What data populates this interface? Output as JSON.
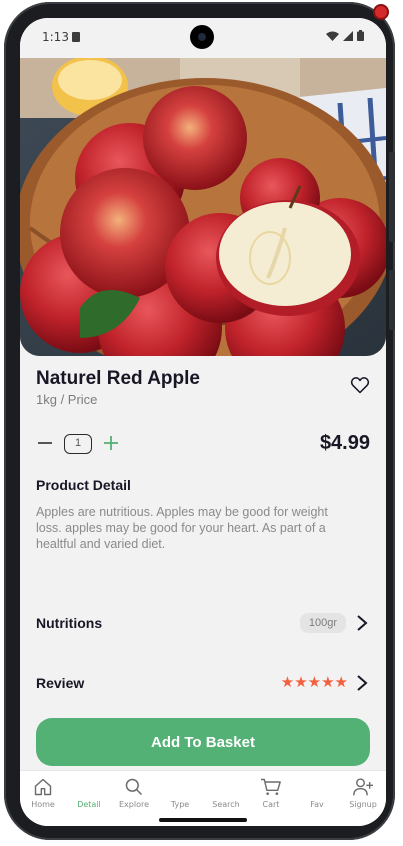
{
  "status": {
    "time": "1:13"
  },
  "product": {
    "title": "Naturel Red Apple",
    "unit": "1kg / Price",
    "quantity": "1",
    "price": "$4.99",
    "detail_heading": "Product Detail",
    "detail_text": "Apples are nutritious. Apples may be good for weight loss. apples may be good for your heart. As part of a healtful and varied diet."
  },
  "rows": {
    "nutritions_label": "Nutritions",
    "nutritions_value": "100gr",
    "review_label": "Review",
    "review_stars": "★★★★★",
    "rating": 5
  },
  "actions": {
    "add_to_basket": "Add To Basket"
  },
  "nav": [
    {
      "label": "Home",
      "icon": "home-icon"
    },
    {
      "label": "Detail",
      "icon": "detail-icon",
      "active": true
    },
    {
      "label": "Explore",
      "icon": "search-icon"
    },
    {
      "label": "Type",
      "icon": "type-icon"
    },
    {
      "label": "Search",
      "icon": "search-icon"
    },
    {
      "label": "Cart",
      "icon": "cart-icon"
    },
    {
      "label": "Fav",
      "icon": "fav-icon"
    },
    {
      "label": "Signup",
      "icon": "add-user-icon"
    }
  ],
  "colors": {
    "accent": "#53b175",
    "stars": "#f3603f",
    "text": "#181725",
    "muted": "#7c7c7c"
  }
}
